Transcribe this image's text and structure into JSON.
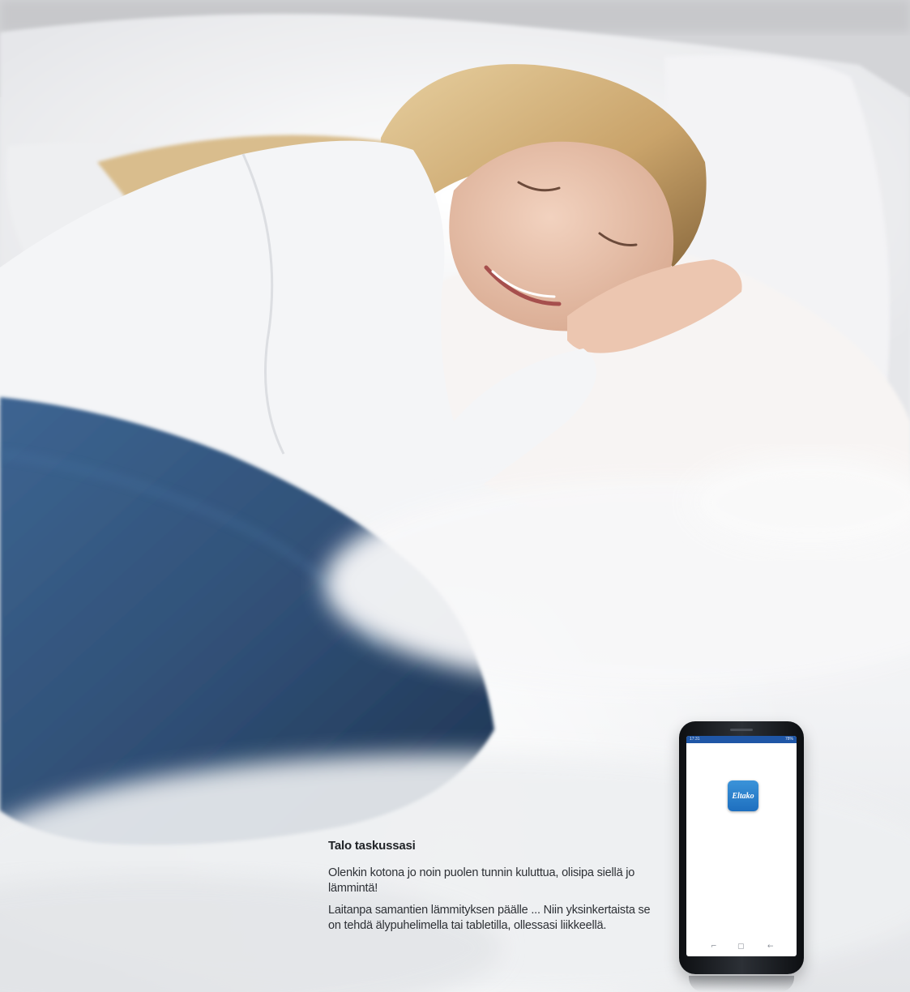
{
  "caption": {
    "title": "Talo taskussasi",
    "paragraph_1": "Olenkin kotona jo noin puolen tunnin kuluttua, olisipa siellä jo lämmintä!",
    "paragraph_2": "Laitanpa samantien lämmityksen päälle ... Niin yksinkertaista se on tehdä älypuhelimella tai tabletilla, ollessasi liikkeellä."
  },
  "phone": {
    "app_icon_label": "Eltako",
    "status_time": "17:31",
    "status_battery": "78%",
    "nav_recent": "⌐",
    "nav_home": "▢",
    "nav_back": "←"
  },
  "colors": {
    "statusbar": "#1f56a6",
    "app_icon": "#2a7fcc",
    "jeans": "#2f4e74",
    "shirt": "#f4f5f7"
  }
}
